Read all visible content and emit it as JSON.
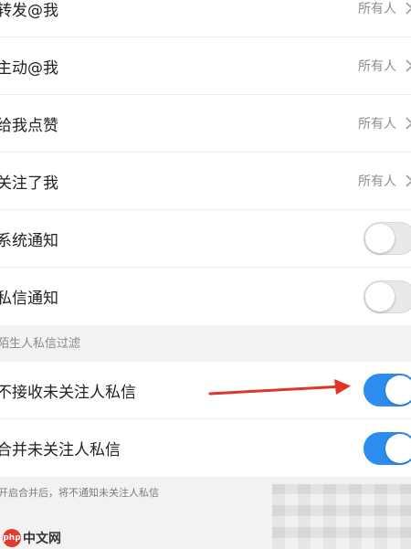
{
  "permission_rows": [
    {
      "label": "转发@我",
      "value": "所有人"
    },
    {
      "label": "主动@我",
      "value": "所有人"
    },
    {
      "label": "给我点赞",
      "value": "所有人"
    },
    {
      "label": "关注了我",
      "value": "所有人"
    }
  ],
  "notification_toggles": [
    {
      "label": "系统通知",
      "on": false
    },
    {
      "label": "私信通知",
      "on": false
    }
  ],
  "filter_section": {
    "header": "陌生人私信过滤",
    "toggles": [
      {
        "label": "不接收未关注人私信",
        "on": true
      },
      {
        "label": "合并未关注人私信",
        "on": true
      }
    ],
    "footnote": "开启合并后，将不通知未关注人私信"
  },
  "watermark": {
    "logo_text": "php",
    "text": "中文网"
  },
  "colors": {
    "toggle_on": "#2d8cf0",
    "toggle_off": "#e9e9e9",
    "arrow": "#e0332a"
  },
  "icons": {
    "chevron": "chevron-right-icon"
  }
}
